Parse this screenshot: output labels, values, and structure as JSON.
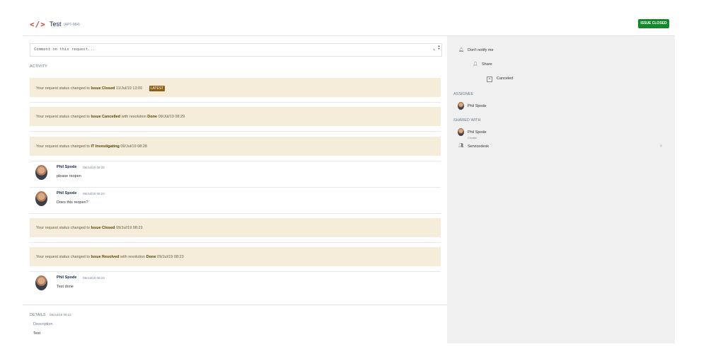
{
  "header": {
    "logo": "</>",
    "title": "Test",
    "issue_key": "(APT-984)",
    "status_button": "ISSUE CLOSED"
  },
  "comment": {
    "placeholder": "Comment on this request..."
  },
  "activity": {
    "label": "ACTIVITY",
    "items": [
      {
        "type": "status",
        "prefix": "Your request status changed to",
        "status": "Issue Closed",
        "middle": "",
        "resolution": "",
        "time": "11/Jul/19 13:00",
        "badge": "LATEST"
      },
      {
        "type": "status",
        "prefix": "Your request status changed to",
        "status": "Issue Cancelled",
        "middle": "with resolution",
        "resolution": "Done",
        "time": "09/Jul/19 08:29",
        "badge": ""
      },
      {
        "type": "status",
        "prefix": "Your request status changed to",
        "status": "IT Investigating",
        "middle": "",
        "resolution": "",
        "time": "09/Jul/19 08:28",
        "badge": ""
      },
      {
        "type": "comment",
        "author": "Phil Spode",
        "time": "09/Jul/19 08:28",
        "body": "please reopen"
      },
      {
        "type": "comment",
        "author": "Phil Spode",
        "time": "09/Jul/19 08:24",
        "body": "Does this reopen?"
      },
      {
        "type": "status",
        "prefix": "Your request status changed to",
        "status": "Issue Closed",
        "middle": "",
        "resolution": "",
        "time": "09/Jul/19 08:23",
        "badge": ""
      },
      {
        "type": "status",
        "prefix": "Your request status changed to",
        "status": "Issue Resolved",
        "middle": "with resolution",
        "resolution": "Done",
        "time": "09/Jul/19 08:23",
        "badge": ""
      },
      {
        "type": "comment",
        "author": "Phil Spode",
        "time": "09/Jul/19 08:23",
        "body": "Test done"
      }
    ]
  },
  "details": {
    "label": "DETAILS",
    "time": "09/Jul/19 08:22",
    "description_label": "Description",
    "description_value": "Test"
  },
  "sidebar": {
    "notify": "Don't notify me",
    "share": "Share",
    "canceled": "Canceled",
    "assignee_label": "ASSIGNEE",
    "assignee": "Phil Spode",
    "shared_label": "SHARED WITH",
    "shared_user": "Phil Spode",
    "shared_user_role": "Creator",
    "shared_group": "Servicedesk"
  },
  "colors": {
    "status_button": "#14892c",
    "status_row": "#f5ecda",
    "latest_badge": "#8f5e0e",
    "logo": "#d04437"
  }
}
